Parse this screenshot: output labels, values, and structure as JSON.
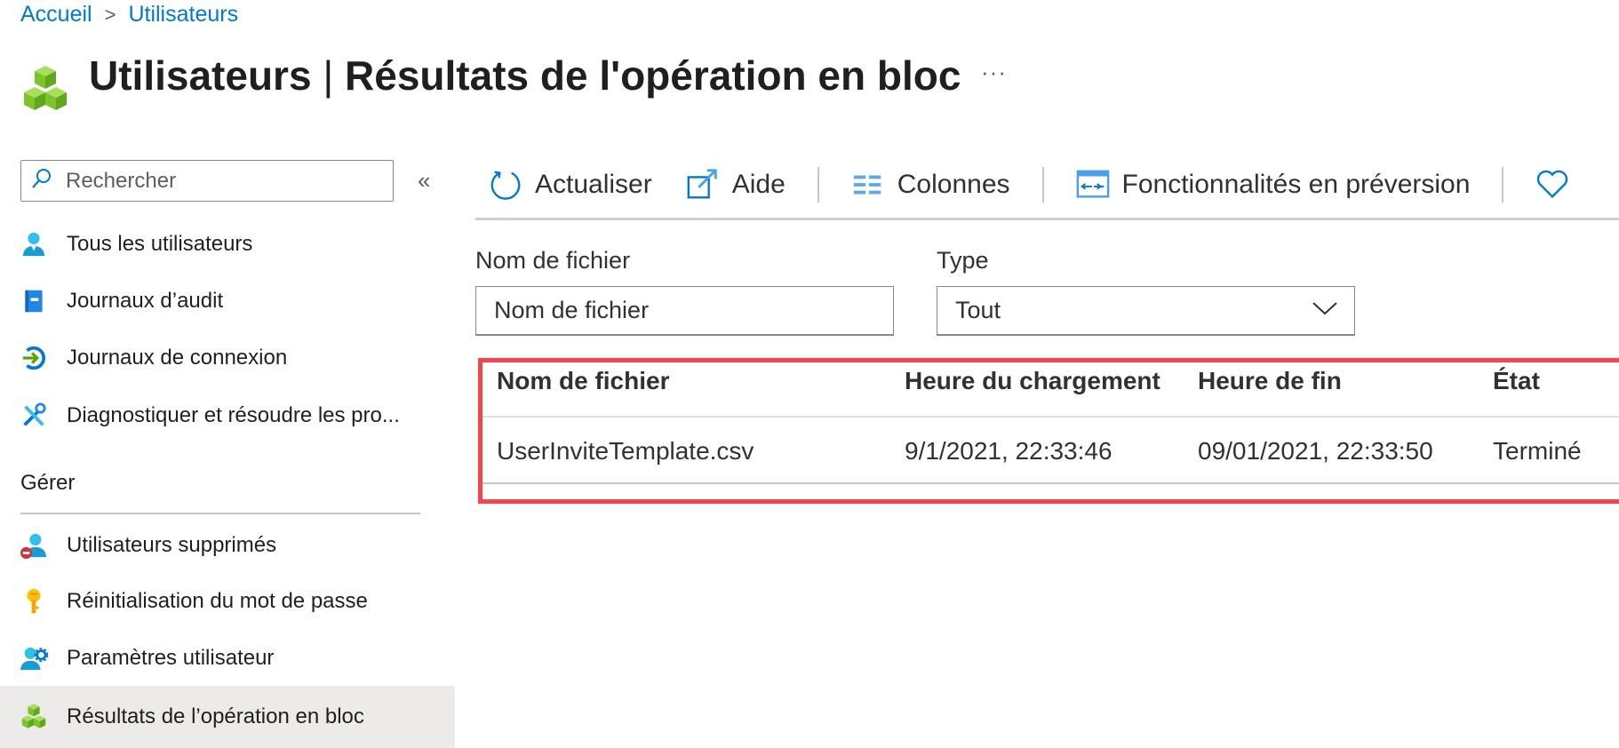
{
  "breadcrumb": [
    {
      "label": "Accueil"
    },
    {
      "label": "Utilisateurs"
    }
  ],
  "breadcrumb_separator": ">",
  "header": {
    "title_strong": "Utilisateurs",
    "title_separator": "|",
    "title_rest": "Résultats de l'opération en bloc",
    "more_label": "···",
    "icon": "cubes-icon"
  },
  "sidebar": {
    "search_placeholder": "Rechercher",
    "collapse_label": "«",
    "items": [
      {
        "label": "Tous les utilisateurs",
        "icon": "user-icon"
      },
      {
        "label": "Journaux d’audit",
        "icon": "book-icon"
      },
      {
        "label": "Journaux de connexion",
        "icon": "sign-in-icon"
      },
      {
        "label": "Diagnostiquer et résoudre les pro...",
        "icon": "tools-icon"
      }
    ],
    "section_title": "Gérer",
    "manage_items": [
      {
        "label": "Utilisateurs supprimés",
        "icon": "deleted-user-icon"
      },
      {
        "label": "Réinitialisation du mot de passe",
        "icon": "key-icon"
      },
      {
        "label": "Paramètres utilisateur",
        "icon": "user-settings-icon"
      },
      {
        "label": "Résultats de l’opération en bloc",
        "icon": "cubes-icon",
        "selected": true
      }
    ]
  },
  "toolbar": {
    "refresh_label": "Actualiser",
    "help_label": "Aide",
    "columns_label": "Colonnes",
    "preview_label": "Fonctionnalités en préversion",
    "feedback_icon": "heart-icon"
  },
  "filters": {
    "filename_label": "Nom de fichier",
    "filename_placeholder": "Nom de fichier",
    "filename_value": "",
    "type_label": "Type",
    "type_value": "Tout"
  },
  "table": {
    "columns": [
      "Nom de fichier",
      "Heure du chargement",
      "Heure de fin",
      "État"
    ],
    "rows": [
      [
        "UserInviteTemplate.csv",
        "9/1/2021, 22:33:46",
        "09/01/2021, 22:33:50",
        "Terminé"
      ]
    ]
  },
  "colors": {
    "accent": "#0078d4",
    "highlight": "#f5454a",
    "selected_bg": "#edebe9",
    "cube_green": "#7cc42a"
  }
}
